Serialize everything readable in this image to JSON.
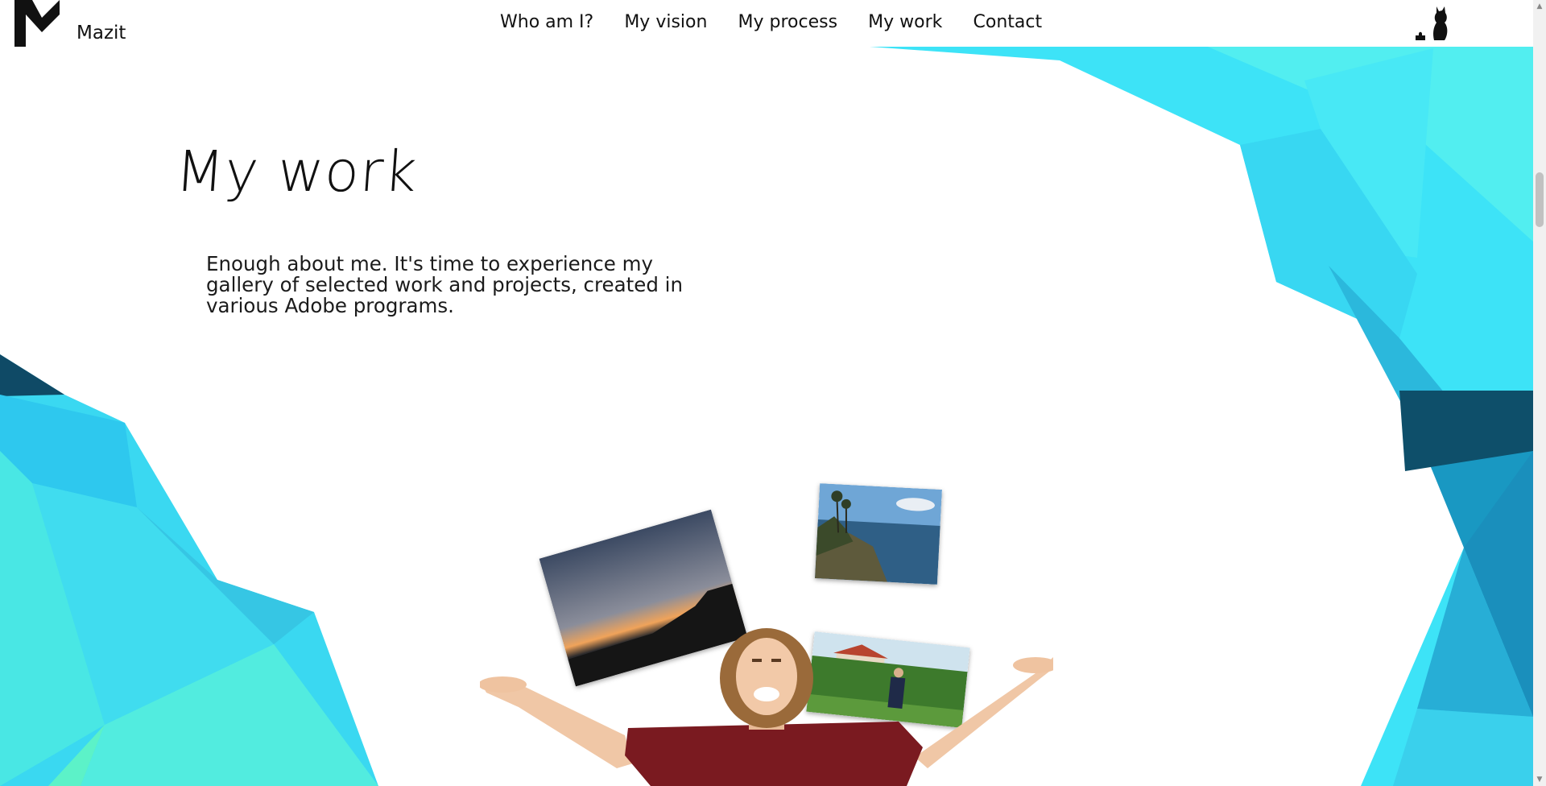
{
  "brand": {
    "name": "Mazit"
  },
  "nav": {
    "items": [
      {
        "label": "Who am I?"
      },
      {
        "label": "My vision"
      },
      {
        "label": "My process"
      },
      {
        "label": "My work"
      },
      {
        "label": "Contact"
      }
    ]
  },
  "section": {
    "title": "My work",
    "intro": "Enough about me. It's time to experience my gallery of selected work and projects, created in various Adobe programs."
  },
  "gallery": {
    "photos": [
      {
        "subject": "sunset over sea"
      },
      {
        "subject": "coastline with palm trees"
      },
      {
        "subject": "person in garden with hedge"
      }
    ]
  },
  "colors": {
    "accent_cyan": "#3de0f8",
    "accent_teal": "#4af0d8",
    "dark_blue": "#0e4f6a",
    "text": "#111111"
  },
  "icons": {
    "logo": "m-logo-icon",
    "cat": "cat-icon"
  }
}
